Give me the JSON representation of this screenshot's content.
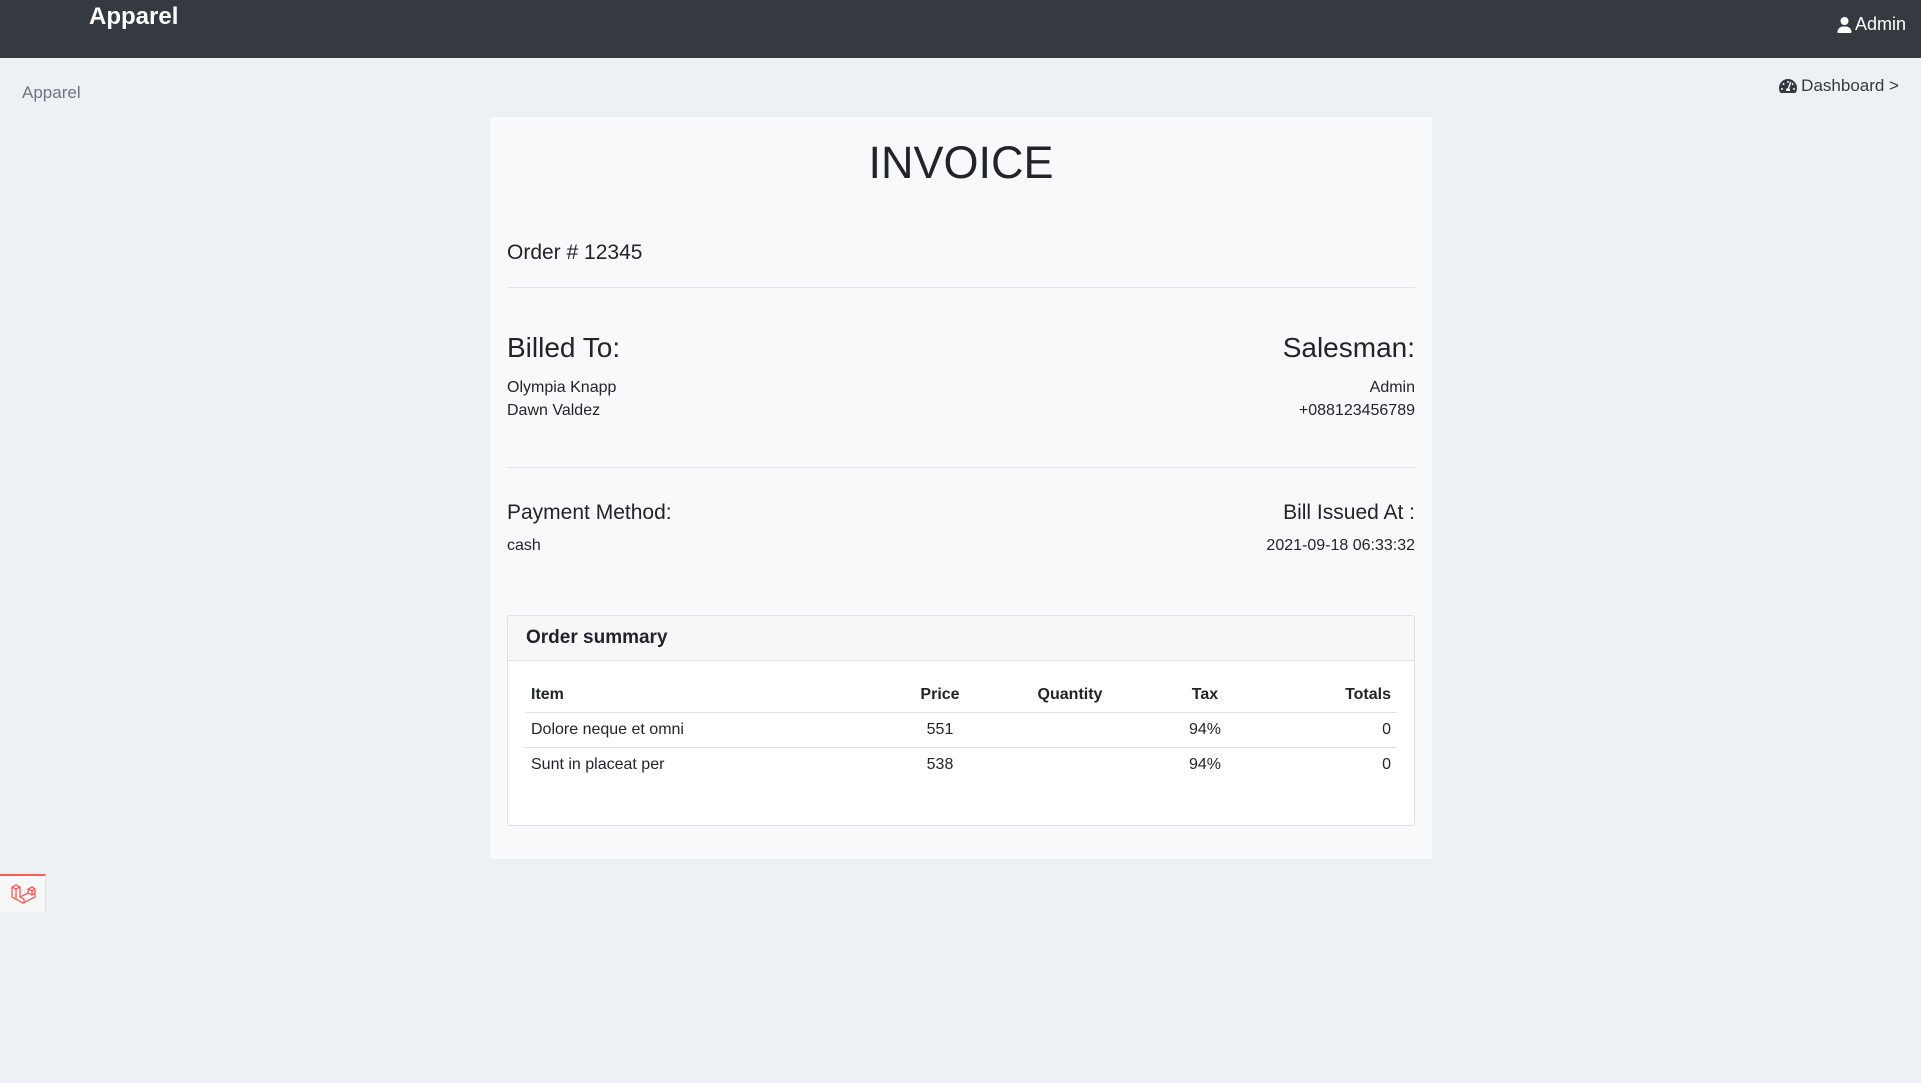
{
  "navbar": {
    "brand": "Apparel",
    "user": "Admin",
    "user_icon": "user-icon"
  },
  "breadcrumb": {
    "left": "Apparel",
    "right": "Dashboard >",
    "right_icon": "tachometer-icon"
  },
  "invoice": {
    "title": "INVOICE",
    "order": "Order # 12345",
    "billed_to": {
      "heading": "Billed To:",
      "lines": [
        "Olympia Knapp",
        "Dawn Valdez"
      ]
    },
    "salesman": {
      "heading": "Salesman:",
      "lines": [
        "Admin",
        "+088123456789"
      ]
    },
    "payment": {
      "heading": "Payment Method:",
      "value": "cash"
    },
    "issued": {
      "heading": "Bill Issued At :",
      "value": "2021-09-18 06:33:32"
    },
    "summary": {
      "title": "Order summary",
      "columns": [
        "Item",
        "Price",
        "Quantity",
        "Tax",
        "Totals"
      ],
      "rows": [
        [
          "Dolore neque et omni",
          "551",
          "",
          "94%",
          "0"
        ],
        [
          "Sunt in placeat per",
          "538",
          "",
          "94%",
          "0"
        ]
      ]
    }
  },
  "debug_icon": "laravel-icon"
}
